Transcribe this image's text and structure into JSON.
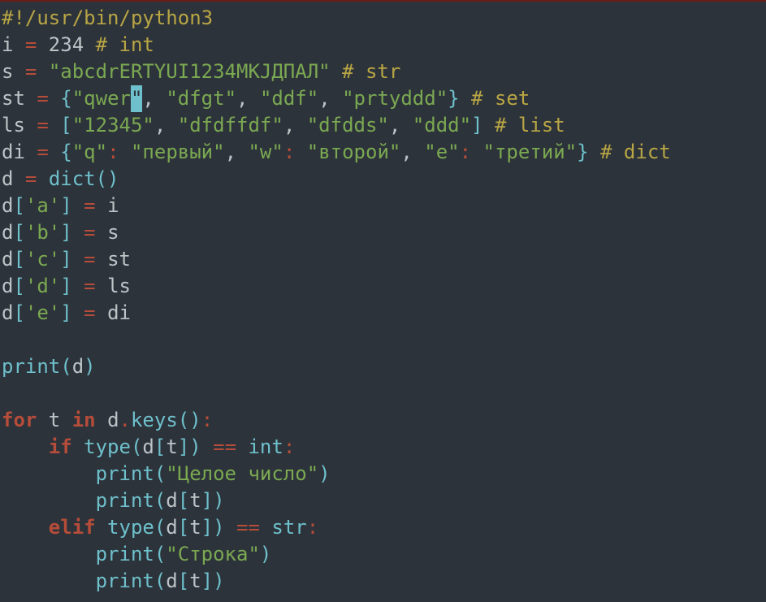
{
  "cursor": {
    "line": 3,
    "col": 11
  },
  "tokens": [
    [
      [
        "#!/usr/bin/python3",
        "s-comment"
      ]
    ],
    [
      [
        "i ",
        "s-default"
      ],
      [
        "=",
        "s-op"
      ],
      [
        " 234 ",
        "s-default"
      ],
      [
        "# int",
        "s-comment"
      ]
    ],
    [
      [
        "s ",
        "s-default"
      ],
      [
        "=",
        "s-op"
      ],
      [
        " ",
        "s-default"
      ],
      [
        "\"abcdrERTYUI1234MKJДПАЛ\"",
        "s-string"
      ],
      [
        " ",
        "s-default"
      ],
      [
        "# str",
        "s-comment"
      ]
    ],
    [
      [
        "st ",
        "s-default"
      ],
      [
        "=",
        "s-op"
      ],
      [
        " ",
        "s-default"
      ],
      [
        "{",
        "s-bracket"
      ],
      [
        "\"qwer\"",
        "s-string"
      ],
      [
        ", ",
        "s-default"
      ],
      [
        "\"dfgt\"",
        "s-string"
      ],
      [
        ", ",
        "s-default"
      ],
      [
        "\"ddf\"",
        "s-string"
      ],
      [
        ", ",
        "s-default"
      ],
      [
        "\"prtyddd\"",
        "s-string"
      ],
      [
        "}",
        "s-bracket"
      ],
      [
        " ",
        "s-default"
      ],
      [
        "# set",
        "s-comment"
      ]
    ],
    [
      [
        "ls ",
        "s-default"
      ],
      [
        "=",
        "s-op"
      ],
      [
        " ",
        "s-default"
      ],
      [
        "[",
        "s-bracket"
      ],
      [
        "\"12345\"",
        "s-string"
      ],
      [
        ", ",
        "s-default"
      ],
      [
        "\"dfdffdf\"",
        "s-string"
      ],
      [
        ", ",
        "s-default"
      ],
      [
        "\"dfdds\"",
        "s-string"
      ],
      [
        ", ",
        "s-default"
      ],
      [
        "\"ddd\"",
        "s-string"
      ],
      [
        "]",
        "s-bracket"
      ],
      [
        " ",
        "s-default"
      ],
      [
        "# list",
        "s-comment"
      ]
    ],
    [
      [
        "di ",
        "s-default"
      ],
      [
        "=",
        "s-op"
      ],
      [
        " ",
        "s-default"
      ],
      [
        "{",
        "s-bracket"
      ],
      [
        "\"q\"",
        "s-string"
      ],
      [
        ":",
        "s-op"
      ],
      [
        " ",
        "s-default"
      ],
      [
        "\"первый\"",
        "s-string"
      ],
      [
        ", ",
        "s-default"
      ],
      [
        "\"w\"",
        "s-string"
      ],
      [
        ":",
        "s-op"
      ],
      [
        " ",
        "s-default"
      ],
      [
        "\"второй\"",
        "s-string"
      ],
      [
        ", ",
        "s-default"
      ],
      [
        "\"e\"",
        "s-string"
      ],
      [
        ":",
        "s-op"
      ],
      [
        " ",
        "s-default"
      ],
      [
        "\"третий\"",
        "s-string"
      ],
      [
        "}",
        "s-bracket"
      ],
      [
        " ",
        "s-default"
      ],
      [
        "# dict",
        "s-comment"
      ]
    ],
    [
      [
        "d ",
        "s-default"
      ],
      [
        "=",
        "s-op"
      ],
      [
        " ",
        "s-default"
      ],
      [
        "dict",
        "s-func"
      ],
      [
        "()",
        "s-bracket"
      ]
    ],
    [
      [
        "d",
        "s-default"
      ],
      [
        "[",
        "s-bracket"
      ],
      [
        "'a'",
        "s-string"
      ],
      [
        "]",
        "s-bracket"
      ],
      [
        " ",
        "s-default"
      ],
      [
        "=",
        "s-op"
      ],
      [
        " i",
        "s-default"
      ]
    ],
    [
      [
        "d",
        "s-default"
      ],
      [
        "[",
        "s-bracket"
      ],
      [
        "'b'",
        "s-string"
      ],
      [
        "]",
        "s-bracket"
      ],
      [
        " ",
        "s-default"
      ],
      [
        "=",
        "s-op"
      ],
      [
        " s",
        "s-default"
      ]
    ],
    [
      [
        "d",
        "s-default"
      ],
      [
        "[",
        "s-bracket"
      ],
      [
        "'c'",
        "s-string"
      ],
      [
        "]",
        "s-bracket"
      ],
      [
        " ",
        "s-default"
      ],
      [
        "=",
        "s-op"
      ],
      [
        " st",
        "s-default"
      ]
    ],
    [
      [
        "d",
        "s-default"
      ],
      [
        "[",
        "s-bracket"
      ],
      [
        "'d'",
        "s-string"
      ],
      [
        "]",
        "s-bracket"
      ],
      [
        " ",
        "s-default"
      ],
      [
        "=",
        "s-op"
      ],
      [
        " ls",
        "s-default"
      ]
    ],
    [
      [
        "d",
        "s-default"
      ],
      [
        "[",
        "s-bracket"
      ],
      [
        "'e'",
        "s-string"
      ],
      [
        "]",
        "s-bracket"
      ],
      [
        " ",
        "s-default"
      ],
      [
        "=",
        "s-op"
      ],
      [
        " di",
        "s-default"
      ]
    ],
    [],
    [
      [
        "print",
        "s-func"
      ],
      [
        "(",
        "s-bracket"
      ],
      [
        "d",
        "s-default"
      ],
      [
        ")",
        "s-bracket"
      ]
    ],
    [],
    [
      [
        "for",
        "s-keyword"
      ],
      [
        " t ",
        "s-default"
      ],
      [
        "in",
        "s-keyword"
      ],
      [
        " d",
        "s-default"
      ],
      [
        ".",
        "s-op"
      ],
      [
        "keys",
        "s-func"
      ],
      [
        "()",
        "s-bracket"
      ],
      [
        ":",
        "s-op"
      ]
    ],
    [
      [
        "    ",
        "s-default"
      ],
      [
        "if",
        "s-keyword"
      ],
      [
        " ",
        "s-default"
      ],
      [
        "type",
        "s-type"
      ],
      [
        "(",
        "s-bracket"
      ],
      [
        "d",
        "s-default"
      ],
      [
        "[",
        "s-bracket"
      ],
      [
        "t",
        "s-default"
      ],
      [
        "]",
        "s-bracket"
      ],
      [
        ")",
        "s-bracket"
      ],
      [
        " ",
        "s-default"
      ],
      [
        "==",
        "s-op"
      ],
      [
        " ",
        "s-default"
      ],
      [
        "int",
        "s-type"
      ],
      [
        ":",
        "s-op"
      ]
    ],
    [
      [
        "        ",
        "s-default"
      ],
      [
        "print",
        "s-func"
      ],
      [
        "(",
        "s-bracket"
      ],
      [
        "\"Целое число\"",
        "s-string"
      ],
      [
        ")",
        "s-bracket"
      ]
    ],
    [
      [
        "        ",
        "s-default"
      ],
      [
        "print",
        "s-func"
      ],
      [
        "(",
        "s-bracket"
      ],
      [
        "d",
        "s-default"
      ],
      [
        "[",
        "s-bracket"
      ],
      [
        "t",
        "s-default"
      ],
      [
        "]",
        "s-bracket"
      ],
      [
        ")",
        "s-bracket"
      ]
    ],
    [
      [
        "    ",
        "s-default"
      ],
      [
        "elif",
        "s-keyword"
      ],
      [
        " ",
        "s-default"
      ],
      [
        "type",
        "s-type"
      ],
      [
        "(",
        "s-bracket"
      ],
      [
        "d",
        "s-default"
      ],
      [
        "[",
        "s-bracket"
      ],
      [
        "t",
        "s-default"
      ],
      [
        "]",
        "s-bracket"
      ],
      [
        ")",
        "s-bracket"
      ],
      [
        " ",
        "s-default"
      ],
      [
        "==",
        "s-op"
      ],
      [
        " ",
        "s-default"
      ],
      [
        "str",
        "s-type"
      ],
      [
        ":",
        "s-op"
      ]
    ],
    [
      [
        "        ",
        "s-default"
      ],
      [
        "print",
        "s-func"
      ],
      [
        "(",
        "s-bracket"
      ],
      [
        "\"Строка\"",
        "s-string"
      ],
      [
        ")",
        "s-bracket"
      ]
    ],
    [
      [
        "        ",
        "s-default"
      ],
      [
        "print",
        "s-func"
      ],
      [
        "(",
        "s-bracket"
      ],
      [
        "d",
        "s-default"
      ],
      [
        "[",
        "s-bracket"
      ],
      [
        "t",
        "s-default"
      ],
      [
        "]",
        "s-bracket"
      ],
      [
        ")",
        "s-bracket"
      ]
    ]
  ]
}
